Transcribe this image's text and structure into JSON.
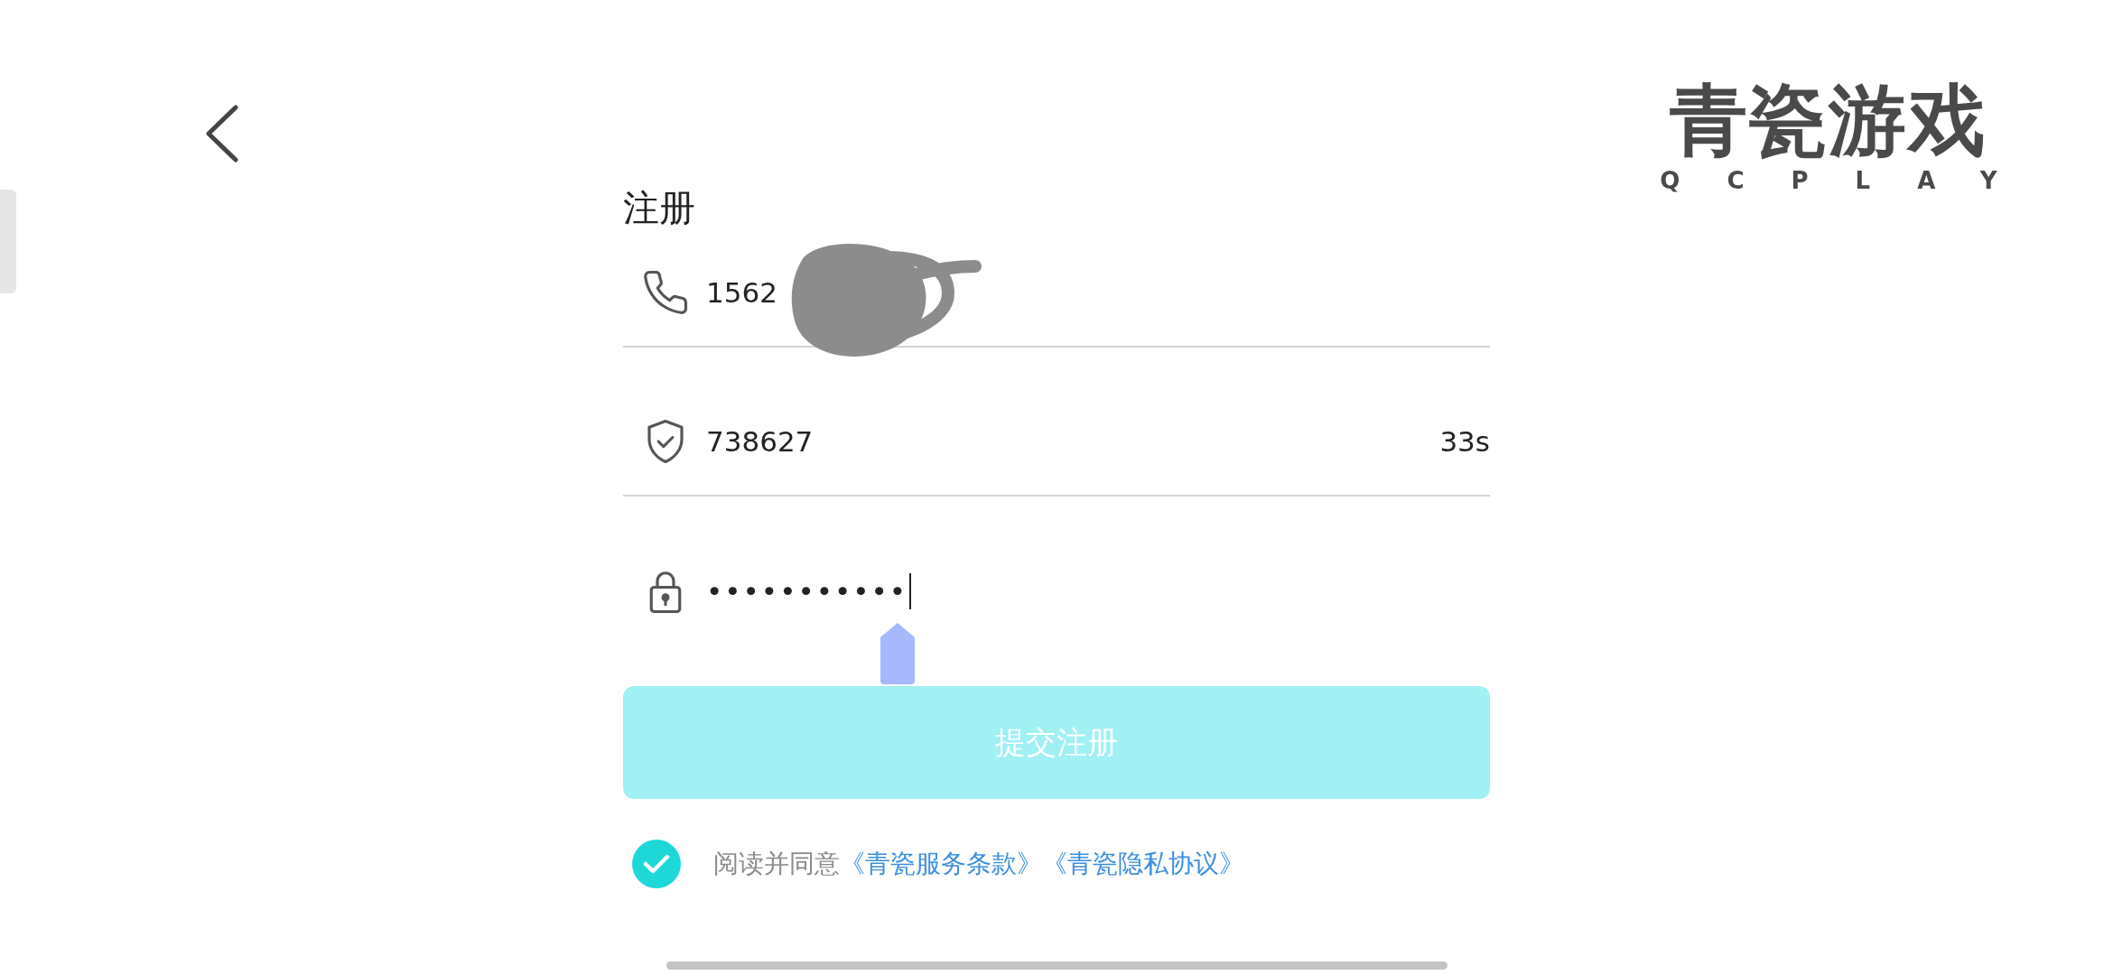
{
  "logo": {
    "title": "青瓷游戏",
    "subtitle": "QCPLAY"
  },
  "form": {
    "title": "注册",
    "fields": [
      {
        "kind": "phone",
        "value": "1562",
        "redacted": true
      },
      {
        "kind": "code",
        "value": "738627",
        "countdown": "33s"
      },
      {
        "kind": "password",
        "value": "•••••••••••",
        "focused": true
      }
    ],
    "submit": {
      "label": "提交注册",
      "disabled": true
    },
    "agreement": {
      "checked": true,
      "text": "阅读并同意",
      "links": [
        "《青瓷服务条款》",
        "《青瓷隐私协议》"
      ]
    }
  }
}
